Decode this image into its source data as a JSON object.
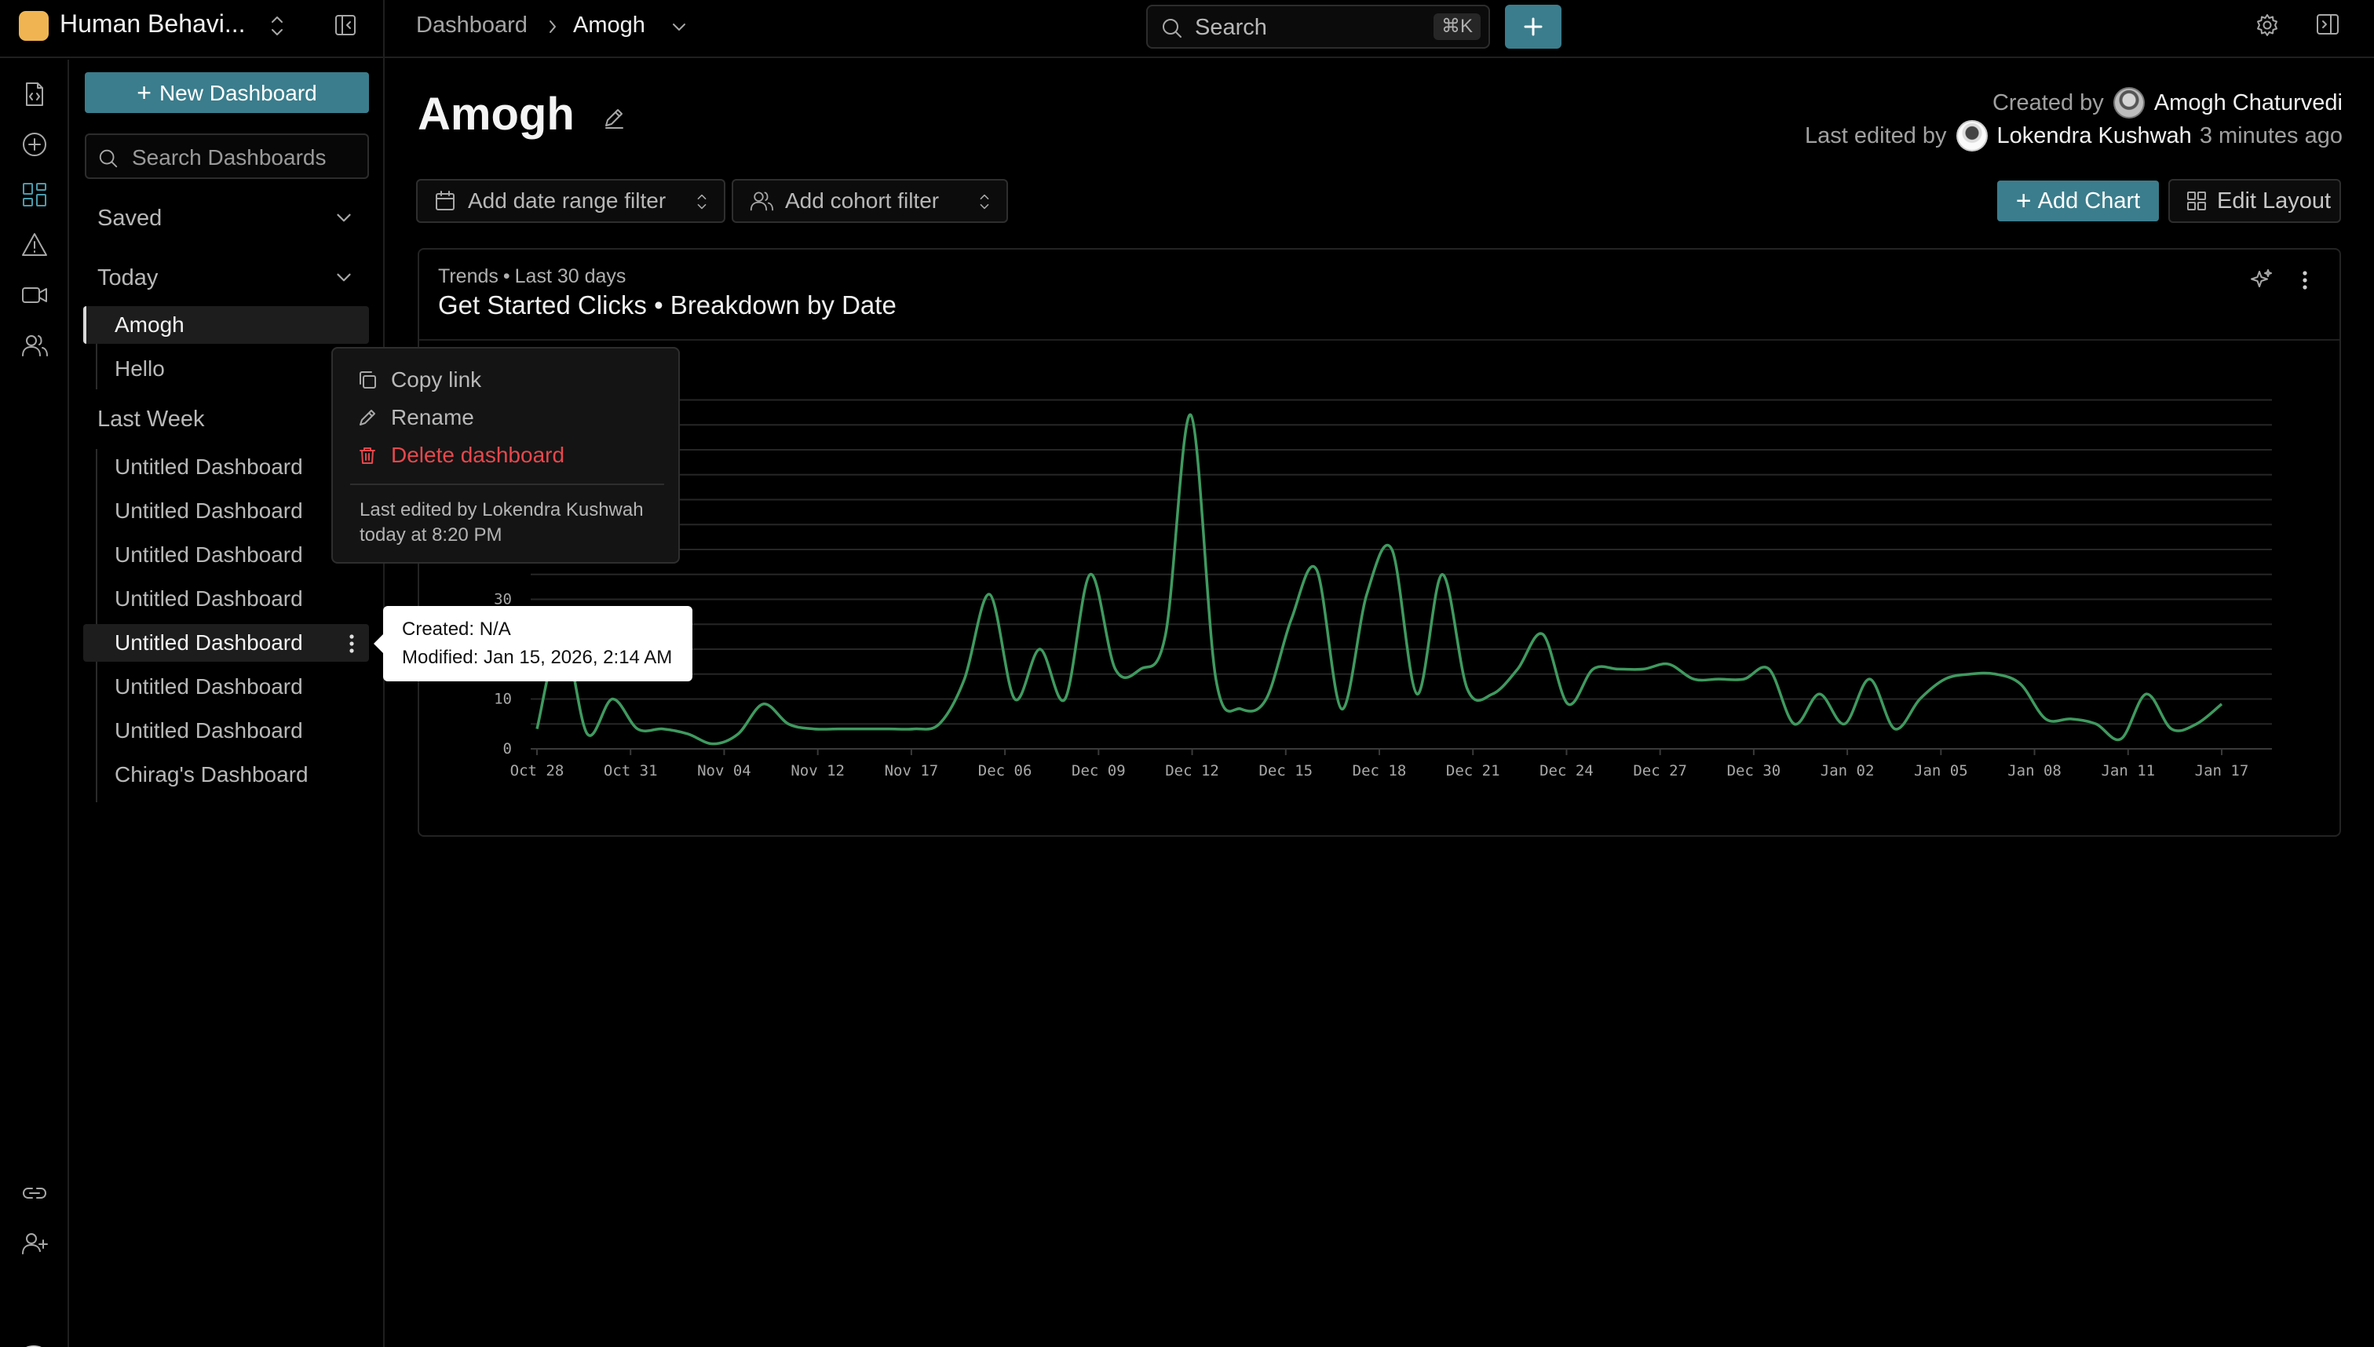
{
  "workspace": {
    "name": "Human Behavi..."
  },
  "breadcrumb": {
    "root": "Dashboard",
    "current": "Amogh"
  },
  "search": {
    "label": "Search",
    "shortcut": "⌘K"
  },
  "rail": {
    "items": [
      "file-code-icon",
      "plus-circle-icon",
      "dashboard-grid-icon",
      "alert-triangle-icon",
      "video-icon",
      "users-icon"
    ],
    "bottom": [
      "link-icon",
      "user-plus-icon",
      "avatar"
    ],
    "active": "dashboard-grid-icon"
  },
  "sidebar": {
    "new_dashboard": "New Dashboard",
    "search_placeholder": "Search Dashboards",
    "saved_label": "Saved",
    "today_label": "Today",
    "today_items": [
      "Amogh",
      "Hello"
    ],
    "last_week_label": "Last Week",
    "last_week_items": [
      "Untitled Dashboard",
      "Untitled Dashboard",
      "Untitled Dashboard",
      "Untitled Dashboard",
      "Untitled Dashboard",
      "Untitled Dashboard",
      "Untitled Dashboard",
      "Chirag's Dashboard"
    ]
  },
  "header": {
    "title": "Amogh",
    "created_by_label": "Created by",
    "created_by": "Amogh Chaturvedi",
    "last_edited_label": "Last edited by",
    "last_edited_by": "Lokendra Kushwah",
    "last_edited_ago": "3 minutes ago"
  },
  "filters": {
    "date_range": "Add date range filter",
    "cohort": "Add cohort filter"
  },
  "actions": {
    "add_chart": "Add Chart",
    "edit_layout": "Edit Layout"
  },
  "card": {
    "kind": "Trends",
    "period": "Last 30 days",
    "title": "Get Started Clicks • Breakdown by Date"
  },
  "context_menu": {
    "copy_link": "Copy link",
    "rename": "Rename",
    "delete": "Delete dashboard",
    "edited_line1": "Last edited by Lokendra Kushwah",
    "edited_line2": "today at 8:20 PM"
  },
  "tooltip": {
    "created": "Created: N/A",
    "modified": "Modified: Jan 15, 2026, 2:14 AM"
  },
  "colors": {
    "accent": "#3b7d8c",
    "line": "#3f9a5f",
    "danger": "#e5484d",
    "workspace": "#f0b552"
  },
  "chart_data": {
    "type": "line",
    "title": "Get Started Clicks • Breakdown by Date",
    "x_ticks": [
      "Oct 28",
      "Oct 31",
      "Nov 04",
      "Nov 12",
      "Nov 17",
      "Dec 06",
      "Dec 09",
      "Dec 12",
      "Dec 15",
      "Dec 18",
      "Dec 21",
      "Dec 24",
      "Dec 27",
      "Dec 30",
      "Jan 02",
      "Jan 05",
      "Jan 08",
      "Jan 11",
      "Jan 17"
    ],
    "y_ticks": [
      0,
      10,
      30
    ],
    "ylim": [
      0,
      70
    ],
    "grid": true,
    "series": [
      {
        "values": [
          4,
          23,
          3,
          10,
          4,
          4,
          3,
          1,
          3,
          9,
          5,
          4,
          4,
          4,
          4,
          4,
          5,
          14,
          31,
          10,
          20,
          10,
          35,
          16,
          16,
          23,
          67,
          14,
          8,
          10,
          26,
          36,
          8,
          31,
          40,
          11,
          35,
          12,
          11,
          16,
          23,
          9,
          16,
          16,
          16,
          17,
          14,
          14,
          14,
          16,
          5,
          11,
          5,
          14,
          4,
          10,
          14,
          15,
          15,
          13,
          6,
          6,
          5,
          2,
          11,
          4,
          5,
          9
        ]
      }
    ]
  }
}
